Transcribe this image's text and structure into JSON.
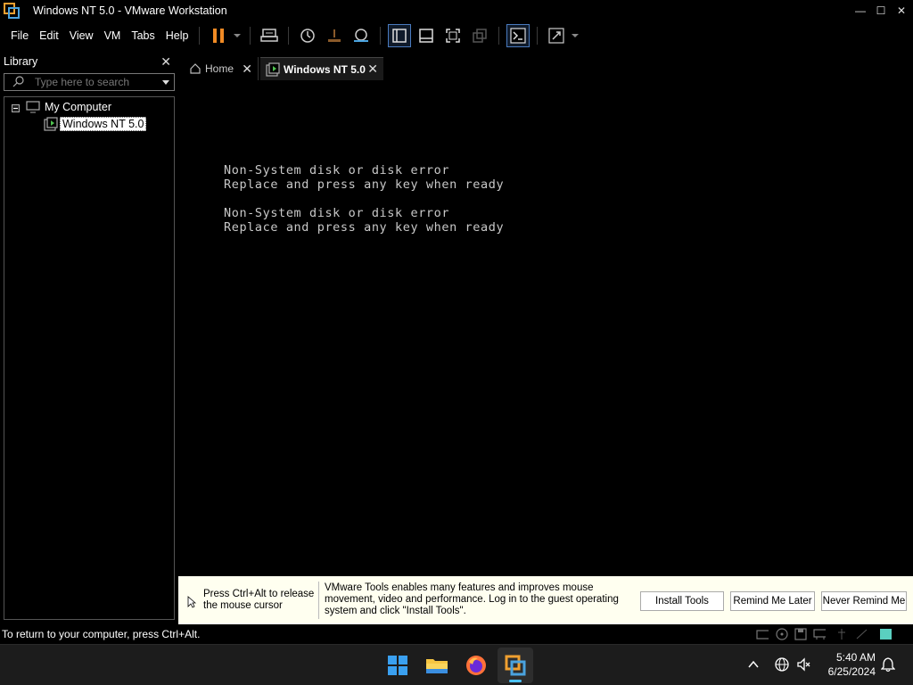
{
  "window": {
    "title": "Windows NT 5.0 - VMware Workstation",
    "minimize": "—",
    "maximize": "☐",
    "close": "✕"
  },
  "menu": [
    "File",
    "Edit",
    "View",
    "VM",
    "Tabs",
    "Help"
  ],
  "toolbar": {
    "buttons": [
      "pause-icon",
      "send-ctrl-alt-del-icon",
      "snapshot-icon",
      "revert-snapshot-icon",
      "snapshot-manager-icon",
      "library-view-icon",
      "thumbnail-bar-icon",
      "full-screen-icon",
      "unity-icon",
      "console-view-icon",
      "stretch-guest-icon"
    ],
    "accent_color": "#f08a24"
  },
  "library": {
    "title": "Library",
    "search_placeholder": "Type here to search",
    "tree": {
      "root": "My Computer",
      "vm": "Windows NT 5.0"
    }
  },
  "tabs": [
    {
      "label": "Home",
      "active": false
    },
    {
      "label": "Windows NT 5.0",
      "active": true
    }
  ],
  "vm_console": {
    "lines": [
      "Non-System disk or disk error",
      "Replace and press any key when ready",
      "Non-System disk or disk error",
      "Replace and press any key when ready"
    ]
  },
  "infobar": {
    "release_hint": "Press Ctrl+Alt to release the mouse cursor",
    "tools_message": "VMware Tools enables many features and improves mouse movement, video and performance. Log in to the guest operating system and click \"Install Tools\".",
    "install_button": "Install Tools",
    "remind_button": "Remind Me Later",
    "never_button": "Never Remind Me"
  },
  "statusbar": {
    "text": "To return to your computer, press Ctrl+Alt."
  },
  "taskbar": {
    "apps": [
      "windows-start-icon",
      "file-explorer-icon",
      "firefox-icon",
      "vmware-icon"
    ],
    "time": "5:40 AM",
    "date": "6/25/2024"
  }
}
